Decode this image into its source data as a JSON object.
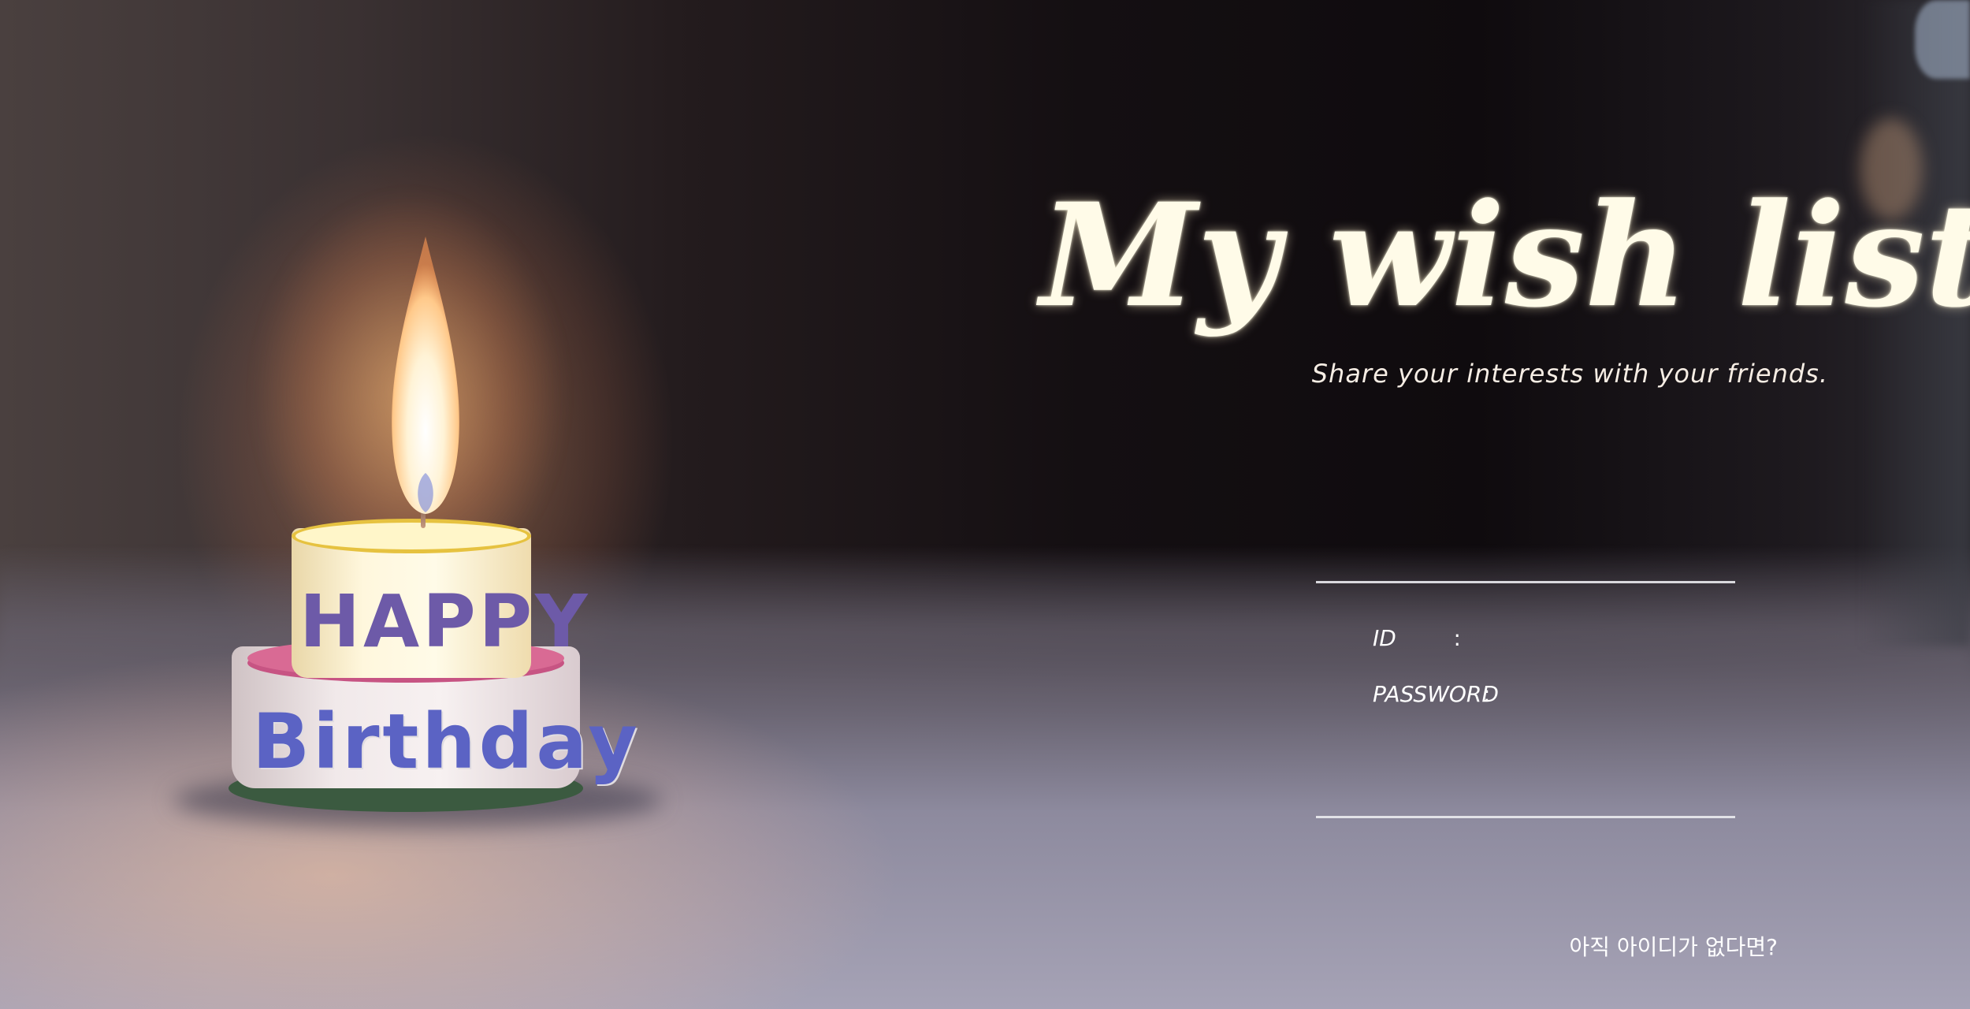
{
  "header": {
    "title": "My wish list",
    "subtitle": "Share your interests with your friends."
  },
  "login_form": {
    "id_label": "ID",
    "id_colon": ":",
    "id_value": "",
    "password_label": "PASSWORD",
    "password_colon": ":",
    "password_value": ""
  },
  "signup": {
    "link_text": "아직 아이디가 없다면?"
  },
  "background_image": {
    "cake_text_top": "HAPPY",
    "cake_text_bottom": "Birthday"
  },
  "colors": {
    "title_text": "#fffbe8",
    "divider": "#ebebf0",
    "label_text": "#ffffff"
  }
}
